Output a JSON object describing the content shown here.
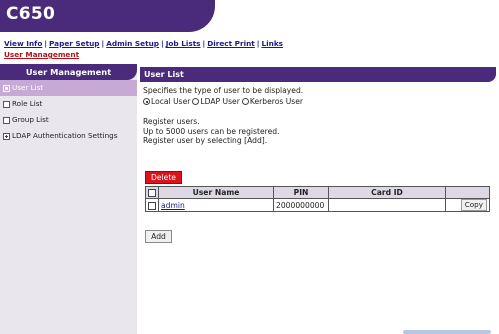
{
  "app": {
    "title": "C650"
  },
  "top_nav": {
    "items": [
      {
        "label": "View Info"
      },
      {
        "label": "Paper Setup"
      },
      {
        "label": "Admin Setup"
      },
      {
        "label": "Job Lists"
      },
      {
        "label": "Direct Print"
      },
      {
        "label": "Links"
      }
    ],
    "active_label": "User Management",
    "separator": "|"
  },
  "sidebar": {
    "title": "User Management",
    "items": [
      {
        "label": "User List",
        "selected": true
      },
      {
        "label": "Role List"
      },
      {
        "label": "Group List"
      },
      {
        "label": "LDAP Authentication Settings"
      }
    ]
  },
  "main": {
    "section_title": "User List",
    "type_description": "Specifies the type of user to be displayed.",
    "user_types": [
      {
        "label": "Local User",
        "checked": true
      },
      {
        "label": "LDAP User",
        "checked": false
      },
      {
        "label": "Kerberos User",
        "checked": false
      }
    ],
    "notes": [
      "Register users.",
      "Up to 5000 users can be registered.",
      "Register user by selecting [Add]."
    ],
    "delete_label": "Delete",
    "add_label": "Add",
    "table": {
      "headers": [
        "User Name",
        "PIN",
        "Card ID"
      ],
      "rows": [
        {
          "user_name": "admin",
          "pin": "2000000000",
          "card_id": "",
          "copy_label": "Copy"
        }
      ]
    }
  },
  "colors": {
    "accent": "#4a2a7a",
    "selected": "#c8a9d6",
    "danger": "#d9141b",
    "link": "#1b1b8c"
  }
}
